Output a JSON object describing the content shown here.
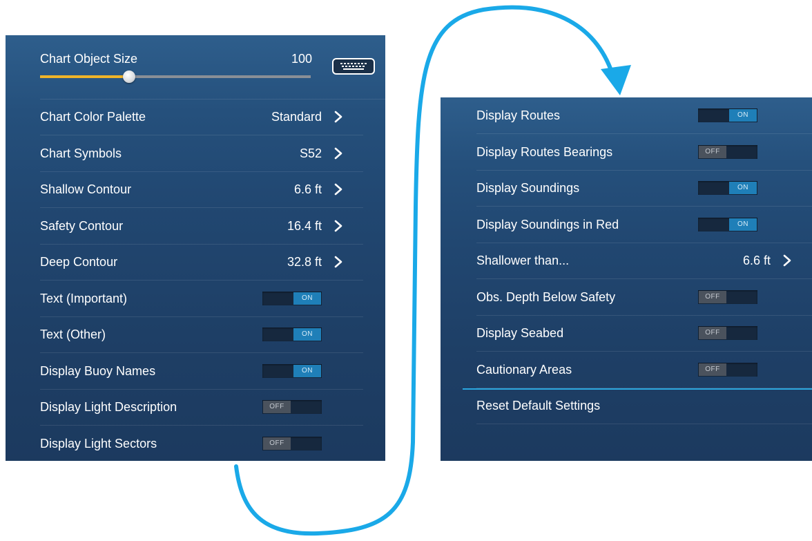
{
  "left_panel": {
    "slider": {
      "label": "Chart Object Size",
      "value": "100",
      "fill_fraction": 0.33
    },
    "rows": [
      {
        "label": "Chart Color Palette",
        "value": "Standard",
        "type": "nav"
      },
      {
        "label": "Chart Symbols",
        "value": "S52",
        "type": "nav"
      },
      {
        "label": "Shallow Contour",
        "value": "6.6 ft",
        "type": "nav"
      },
      {
        "label": "Safety Contour",
        "value": "16.4 ft",
        "type": "nav"
      },
      {
        "label": "Deep Contour",
        "value": "32.8 ft",
        "type": "nav"
      },
      {
        "label": "Text (Important)",
        "state": "ON",
        "type": "toggle"
      },
      {
        "label": "Text (Other)",
        "state": "ON",
        "type": "toggle"
      },
      {
        "label": "Display Buoy Names",
        "state": "ON",
        "type": "toggle"
      },
      {
        "label": "Display Light Description",
        "state": "OFF",
        "type": "toggle"
      },
      {
        "label": "Display Light Sectors",
        "state": "OFF",
        "type": "toggle"
      }
    ]
  },
  "right_panel": {
    "rows": [
      {
        "label": "Display Routes",
        "state": "ON",
        "type": "toggle"
      },
      {
        "label": "Display Routes Bearings",
        "state": "OFF",
        "type": "toggle"
      },
      {
        "label": "Display Soundings",
        "state": "ON",
        "type": "toggle"
      },
      {
        "label": "Display Soundings in Red",
        "state": "ON",
        "type": "toggle"
      },
      {
        "label": "Shallower than...",
        "value": "6.6 ft",
        "type": "nav"
      },
      {
        "label": "Obs. Depth Below Safety",
        "state": "OFF",
        "type": "toggle"
      },
      {
        "label": "Display Seabed",
        "state": "OFF",
        "type": "toggle"
      },
      {
        "label": "Cautionary Areas",
        "state": "OFF",
        "type": "toggle"
      },
      {
        "label": "Reset Default Settings",
        "type": "action"
      }
    ]
  },
  "colors": {
    "accent": "#2aa7df",
    "toggle_on": "#1f7fb8",
    "slider_fill": "#f0b429"
  },
  "icons": {
    "keyboard": "keyboard-icon",
    "chevron": "chevron-right-icon",
    "flow_arrow": "continuation-arrow"
  }
}
